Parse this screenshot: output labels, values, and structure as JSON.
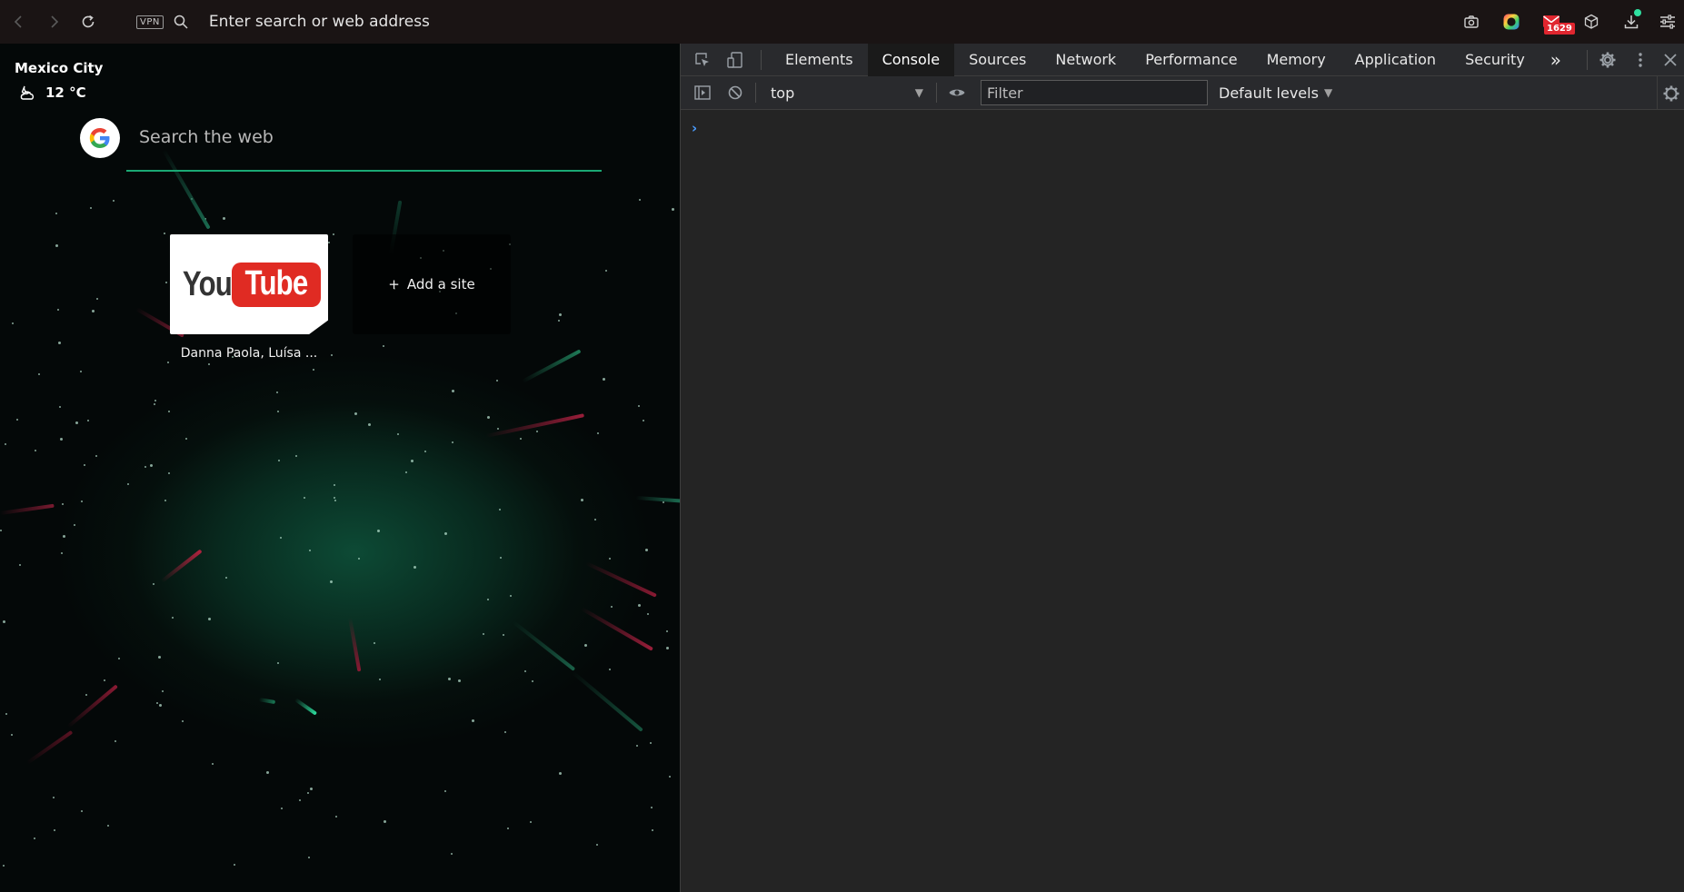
{
  "browser": {
    "vpn_label": "VPN",
    "address_placeholder": "Enter search or web address",
    "mail_count": "1629",
    "colors": {
      "toolbar_bg": "#1a1414",
      "mail_badge": "#e0262f",
      "download_dot": "#2fe0a0"
    }
  },
  "new_tab": {
    "weather": {
      "city": "Mexico City",
      "temperature": "12 °C"
    },
    "search_placeholder": "Search the web",
    "speed_dial": [
      {
        "logo_text_1": "You",
        "logo_text_2": "Tube",
        "caption": "Danna Paola, Luísa ..."
      },
      {
        "label": "Add a site",
        "plus": "+"
      }
    ],
    "colors": {
      "search_underline": "#1aa874"
    }
  },
  "devtools": {
    "tabs": [
      "Elements",
      "Console",
      "Sources",
      "Network",
      "Performance",
      "Memory",
      "Application",
      "Security"
    ],
    "active_tab": "Console",
    "more_tabs": "»",
    "context": "top",
    "filter_placeholder": "Filter",
    "levels": "Default levels",
    "prompt": "›"
  }
}
